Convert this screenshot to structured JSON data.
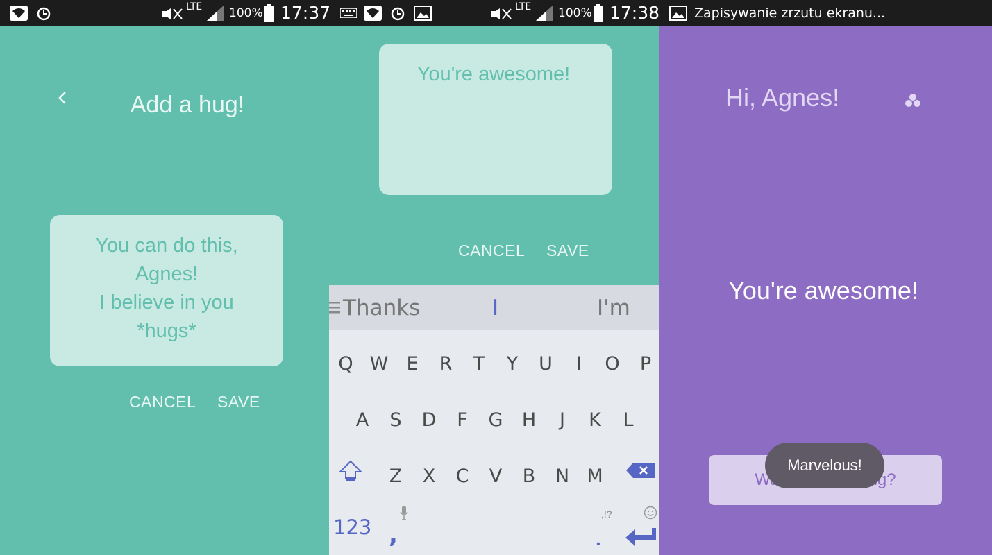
{
  "status_bar_left": {
    "time": "17:37",
    "battery": "100%",
    "network": "LTE"
  },
  "status_bar_right": {
    "time": "17:38",
    "battery": "100%",
    "network": "LTE",
    "notification": "Zapisywanie zrzutu ekranu..."
  },
  "screen1": {
    "title": "Add a hug!",
    "message_lines": [
      "You can do this,",
      "Agnes!",
      "I believe in you",
      "*hugs*"
    ],
    "cancel_label": "CANCEL",
    "save_label": "SAVE"
  },
  "screen2": {
    "message": "You're awesome!",
    "cancel_label": "CANCEL",
    "save_label": "SAVE",
    "keyboard": {
      "suggestions": [
        "Thanks",
        "I",
        "I'm"
      ],
      "row1": [
        "Q",
        "W",
        "E",
        "R",
        "T",
        "Y",
        "U",
        "I",
        "O",
        "P"
      ],
      "row2": [
        "A",
        "S",
        "D",
        "F",
        "G",
        "H",
        "J",
        "K",
        "L"
      ],
      "row3": [
        "Z",
        "X",
        "C",
        "V",
        "B",
        "N",
        "M"
      ],
      "numbers_label": "123",
      "comma": ",",
      "period": ".",
      "punct_hint": ",!?"
    }
  },
  "screen3": {
    "greeting": "Hi, Agnes!",
    "message": "You're awesome!",
    "another_button": "Want another hug?",
    "toast": "Marvelous!"
  },
  "colors": {
    "teal": "#62bfae",
    "card": "#c8eae2",
    "purple": "#8d6cc3",
    "keyboard_accent": "#5566c4"
  }
}
